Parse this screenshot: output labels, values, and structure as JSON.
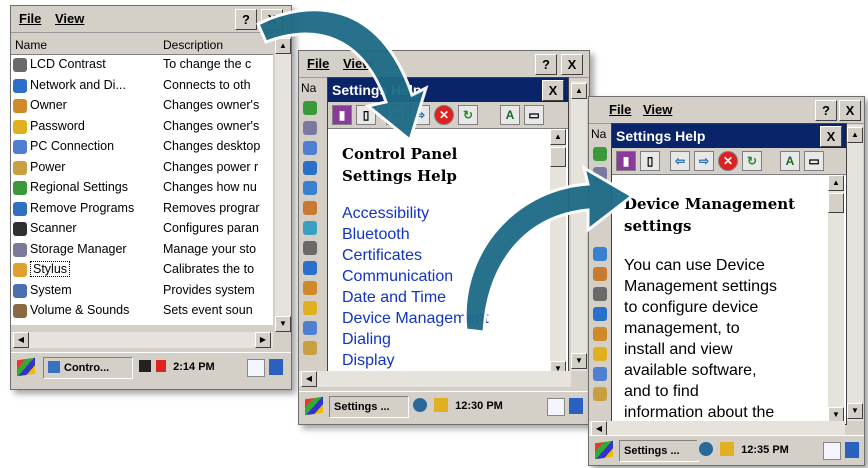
{
  "screen1": {
    "menu": [
      "File",
      "View"
    ],
    "help_btn": "?",
    "close_btn": "X",
    "columns": [
      "Name",
      "Description"
    ],
    "items": [
      {
        "name": "LCD Contrast",
        "desc": "To change the c",
        "icon": "lcd-contrast-icon",
        "color": "#6a6a6a"
      },
      {
        "name": "Network and Di...",
        "desc": "Connects to oth",
        "icon": "network-icon",
        "color": "#2a6fc9"
      },
      {
        "name": "Owner",
        "desc": "Changes owner's",
        "icon": "owner-icon",
        "color": "#d08a2a"
      },
      {
        "name": "Password",
        "desc": "Changes owner's",
        "icon": "password-lock-icon",
        "color": "#e0b020"
      },
      {
        "name": "PC Connection",
        "desc": "Changes desktop",
        "icon": "pc-connection-icon",
        "color": "#4f7fd0"
      },
      {
        "name": "Power",
        "desc": "Changes power r",
        "icon": "power-icon",
        "color": "#c8a040"
      },
      {
        "name": "Regional Settings",
        "desc": "Changes how nu",
        "icon": "regional-globe-icon",
        "color": "#3a9a3a"
      },
      {
        "name": "Remove Programs",
        "desc": "Removes prograr",
        "icon": "remove-programs-icon",
        "color": "#3070c0"
      },
      {
        "name": "Scanner",
        "desc": "Configures paran",
        "icon": "scanner-barcode-icon",
        "color": "#303030"
      },
      {
        "name": "Storage Manager",
        "desc": "Manage your sto",
        "icon": "storage-manager-icon",
        "color": "#7a7a9a"
      },
      {
        "name": "Stylus",
        "desc": "Calibrates the to",
        "icon": "stylus-icon",
        "color": "#e0a030"
      },
      {
        "name": "System",
        "desc": "Provides system",
        "icon": "system-icon",
        "color": "#4a70b0"
      },
      {
        "name": "Volume & Sounds",
        "desc": "Sets event soun",
        "icon": "volume-icon",
        "color": "#8a6a40"
      }
    ],
    "taskbar_task": "Contro...",
    "clock": "2:14 PM"
  },
  "screen2": {
    "menu": [
      "File",
      "View"
    ],
    "partial_col": "Na",
    "help_title": "Settings Help",
    "help_close": "X",
    "heading": "Control Panel Settings Help",
    "links": [
      "Accessibility",
      "Bluetooth",
      "Certificates",
      "Communication",
      "Date and Time",
      "Device Management",
      "Dialing",
      "Display"
    ],
    "taskbar_task": "Settings ...",
    "clock": "12:30 PM"
  },
  "screen3": {
    "menu": [
      "File",
      "View"
    ],
    "partial_col": "Na",
    "help_title": "Settings Help",
    "help_close": "X",
    "heading": "Device Management settings",
    "paragraph_lines": [
      "You can use Device",
      "Management settings",
      "to configure device",
      "management, to",
      "install and view",
      "available software,",
      "and to find",
      "information about the"
    ],
    "taskbar_task": "Settings ...",
    "clock": "12:35 PM"
  },
  "colors": {
    "window_bg": "#d4d0c8",
    "help_title_bar": "#0a246a",
    "link": "#1034c4",
    "arrow_fill": "#1d6a86"
  }
}
